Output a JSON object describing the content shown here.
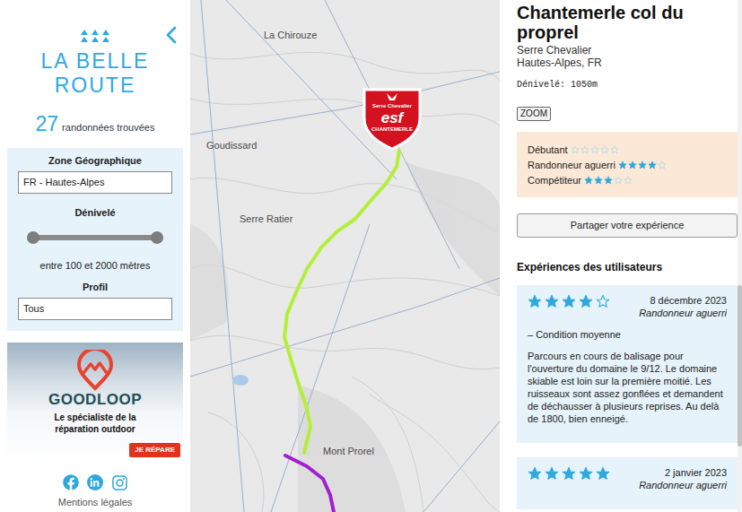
{
  "sidebar": {
    "logo": {
      "line1": "LA BELLE",
      "line2": "ROUTE"
    },
    "results": {
      "count": "27",
      "label": "randonnées trouvées"
    },
    "filters": {
      "zone": {
        "label": "Zone Géographique",
        "value": "FR - Hautes-Alpes"
      },
      "elevation": {
        "label": "Dénivelé",
        "level_low": 0,
        "level_high": 1,
        "reading": "entre 100 et 2000 mètres"
      },
      "profile": {
        "label": "Profil",
        "value": "Tous"
      }
    },
    "ad": {
      "brand": "GOODLOOP",
      "tagline": "Le spécialiste de la réparation outdoor",
      "button": "JE RÉPARE"
    },
    "footer": {
      "link": "Mentions légales"
    }
  },
  "map": {
    "labels": [
      "La Chirouze",
      "Goudissard",
      "Serre Ratier",
      "Mont Prorel"
    ],
    "marker": {
      "top": "Serre Chevalier",
      "brand": "esf",
      "bottom": "CHANTEMERLE"
    },
    "routes": [
      {
        "color": "#b3ef3a"
      },
      {
        "color": "#a21fd0"
      }
    ]
  },
  "detail": {
    "title": "Chantemerle col du proprel",
    "area": "Serre Chevalier",
    "region": "Hautes-Alpes, FR",
    "elevation": "Dénivelé: 1050m",
    "zoom_button": "ZOOM",
    "profiles": [
      {
        "label": "Débutant",
        "stars": 0
      },
      {
        "label": "Randonneur aguerri",
        "stars": 4
      },
      {
        "label": "Compétiteur",
        "stars": 3
      }
    ],
    "share_button": "Partager votre expérience",
    "reviews_title": "Expériences des utilisateurs",
    "reviews": [
      {
        "stars": 4,
        "date": "8 décembre 2023",
        "profile": "Randonneur aguerri",
        "condition": "– Condition moyenne",
        "text": "Parcours en cours de balisage pour l'ouverture du domaine le 9/12. Le domaine skiable est loin sur la première moitié. Les ruisseaux sont assez gonflées et demandent de déchausser à plusieurs reprises. Au delà de 1800, bien enneigé."
      },
      {
        "stars": 5,
        "date": "2 janvier 2023",
        "profile": "Randonneur aguerri",
        "condition": "",
        "text": ""
      }
    ]
  }
}
